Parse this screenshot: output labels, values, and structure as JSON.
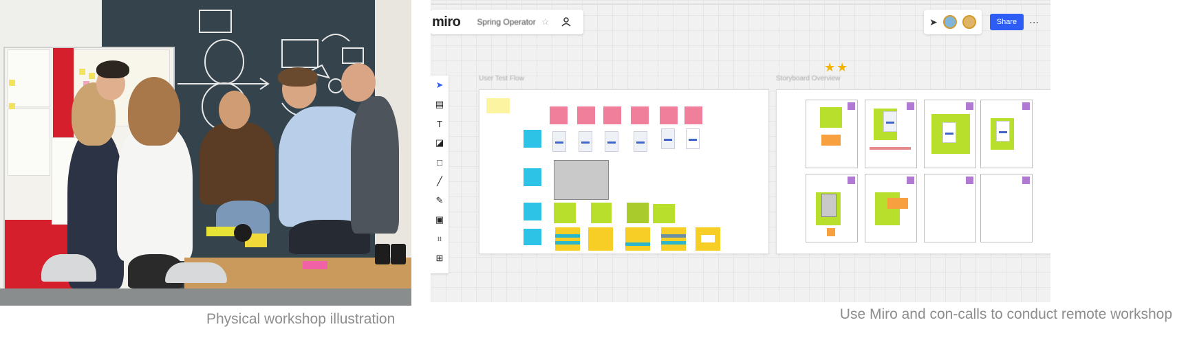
{
  "captions": {
    "left": "Physical workshop illustration",
    "right": "Use Miro and con-calls to conduct remote workshop"
  },
  "miro": {
    "logo": "miro",
    "board_name": "Spring Operator",
    "share_label": "Share",
    "frames": [
      {
        "label": "User Test Flow"
      },
      {
        "label": "Storyboard Overview"
      }
    ],
    "rating_stars": "★★",
    "toolbar_icons": [
      "cursor-icon",
      "template-icon",
      "text-icon",
      "sticky-note-icon",
      "shape-icon",
      "pen-icon",
      "marker-icon",
      "comment-icon",
      "frame-icon",
      "more-tools-icon"
    ],
    "colors": {
      "accent": "#2d5df5",
      "sticky_pink": "#ef7f9a",
      "sticky_cyan": "#2cc3e6",
      "sticky_green": "#b8df2c",
      "sticky_yellow": "#f7ce26",
      "tag_purple": "#b07ad3"
    }
  }
}
